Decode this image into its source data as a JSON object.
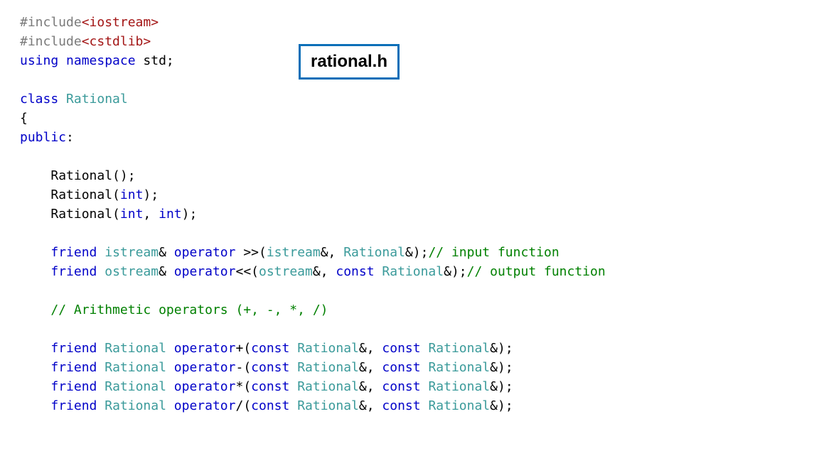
{
  "filename_label": "rational.h",
  "code": {
    "l1_inc": "#include",
    "l1_hdr": "<iostream>",
    "l2_inc": "#include",
    "l2_hdr": "<cstdlib>",
    "l3_using": "using",
    "l3_ns": "namespace",
    "l3_std": "std;",
    "l5_class": "class",
    "l5_name": "Rational",
    "l6_brace": "{",
    "l7_public": "public",
    "l7_colon": ":",
    "l9_ctor0": "Rational();",
    "l10_ctor1a": "Rational(",
    "l10_int": "int",
    "l10_ctor1b": ");",
    "l11_ctor2a": "Rational(",
    "l11_int1": "int",
    "l11_comma": ", ",
    "l11_int2": "int",
    "l11_ctor2b": ");",
    "l13_friend": "friend",
    "l13_istream": "istream",
    "l13_amp1": "& ",
    "l13_op": "operator",
    "l13_sym": " >>(",
    "l13_istream2": "istream",
    "l13_amp2": "&, ",
    "l13_rat": "Rational",
    "l13_tail": "&);",
    "l13_comment": "// input function",
    "l14_friend": "friend",
    "l14_ostream": "ostream",
    "l14_amp1": "& ",
    "l14_op": "operator",
    "l14_sym": "<<(",
    "l14_ostream2": "ostream",
    "l14_amp2": "&, ",
    "l14_const": "const",
    "l14_rat": "Rational",
    "l14_tail": "&);",
    "l14_comment": "// output function",
    "l16_comment": "// Arithmetic operators (+, -, *, /)",
    "op_plus": "+",
    "op_minus": "-",
    "op_star": "*",
    "op_slash": "/",
    "arith_friend": "friend",
    "arith_rat": "Rational",
    "arith_op": "operator",
    "arith_open": "(",
    "arith_const": "const",
    "arith_rat2": "Rational",
    "arith_mid": "&, ",
    "arith_const2": "const",
    "arith_rat3": "Rational",
    "arith_tail": "&);"
  }
}
